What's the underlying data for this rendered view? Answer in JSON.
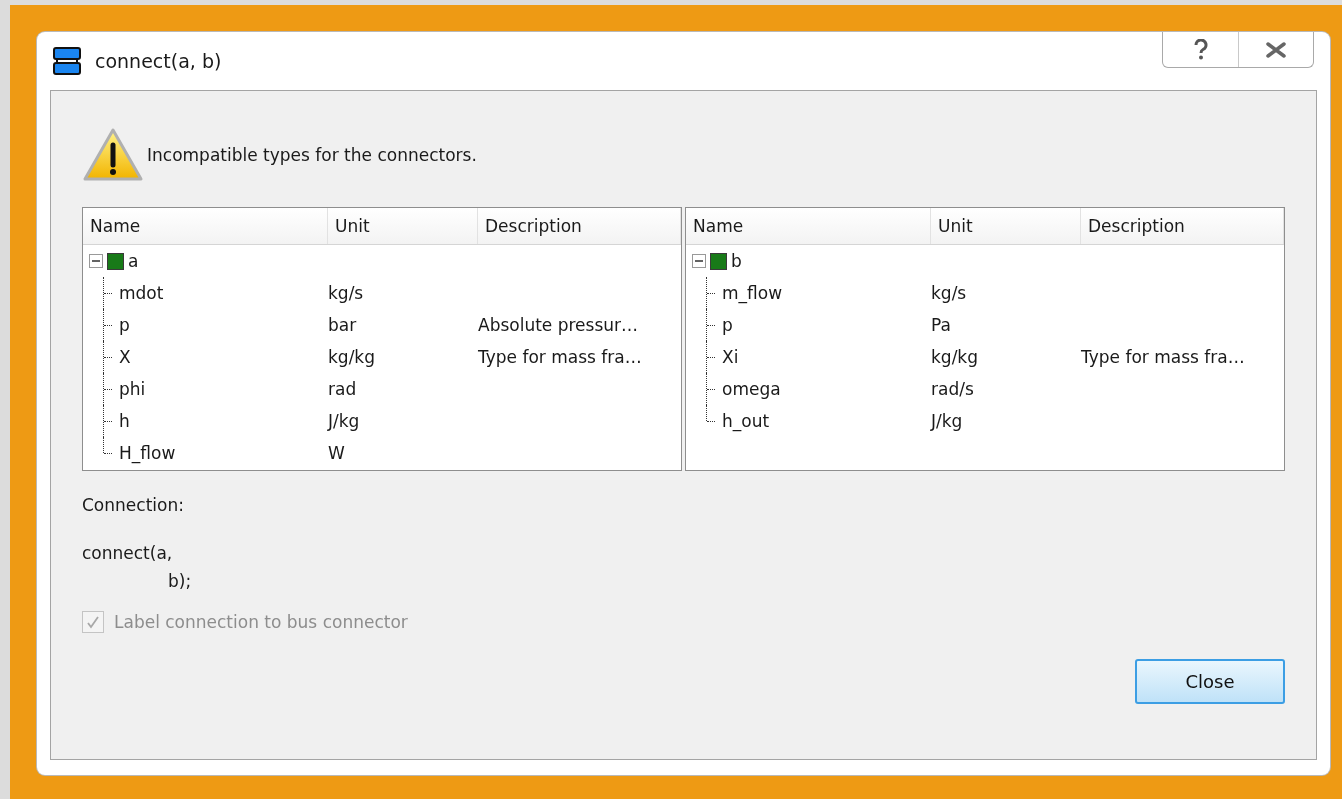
{
  "window": {
    "title": "connect(a, b)"
  },
  "message": "Incompatible types for the connectors.",
  "trees": [
    {
      "columns": [
        "Name",
        "Unit",
        "Description"
      ],
      "root": {
        "label": "a",
        "color": "#187a18",
        "expanded": true,
        "children": [
          {
            "name": "mdot",
            "unit": "kg/s"
          },
          {
            "name": "p",
            "unit": "bar",
            "description": "Absolute pressur…"
          },
          {
            "name": "X",
            "unit": "kg/kg",
            "description": "Type for mass fra…"
          },
          {
            "name": "phi",
            "unit": "rad"
          },
          {
            "name": "h",
            "unit": "J/kg"
          },
          {
            "name": "H_flow",
            "unit": "W"
          }
        ]
      }
    },
    {
      "columns": [
        "Name",
        "Unit",
        "Description"
      ],
      "root": {
        "label": "b",
        "color": "#187a18",
        "expanded": true,
        "children": [
          {
            "name": "m_flow",
            "unit": "kg/s"
          },
          {
            "name": "p",
            "unit": "Pa"
          },
          {
            "name": "Xi",
            "unit": "kg/kg",
            "description": "Type for mass fra…"
          },
          {
            "name": "omega",
            "unit": "rad/s"
          },
          {
            "name": "h_out",
            "unit": "J/kg"
          }
        ]
      }
    }
  ],
  "connection": {
    "label": "Connection:",
    "code_lines": [
      "connect(a,",
      "b);"
    ]
  },
  "bus_option": {
    "label": "Label connection to bus connector",
    "checked": true,
    "disabled": true
  },
  "buttons": [
    {
      "label": "Close",
      "focused": true
    }
  ]
}
